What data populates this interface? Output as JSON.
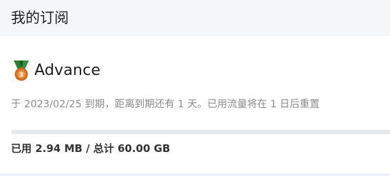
{
  "header": {
    "title": "我的订阅"
  },
  "subscription": {
    "plan_name": "Advance",
    "medal_icon": "bronze-medal-icon",
    "expire_text": "于 2023/02/25 到期，距离到期还有 1 天。已用流量将在 1 日后重置",
    "usage_text": "已用 2.94 MB / 总计 60.00 GB",
    "used_fraction": 5e-05
  },
  "colors": {
    "progress_fill": "#3b7cf0",
    "progress_track": "#e6e8eb",
    "medal_ribbon": "#2e7d32",
    "medal_disc": "#e07b2a"
  }
}
